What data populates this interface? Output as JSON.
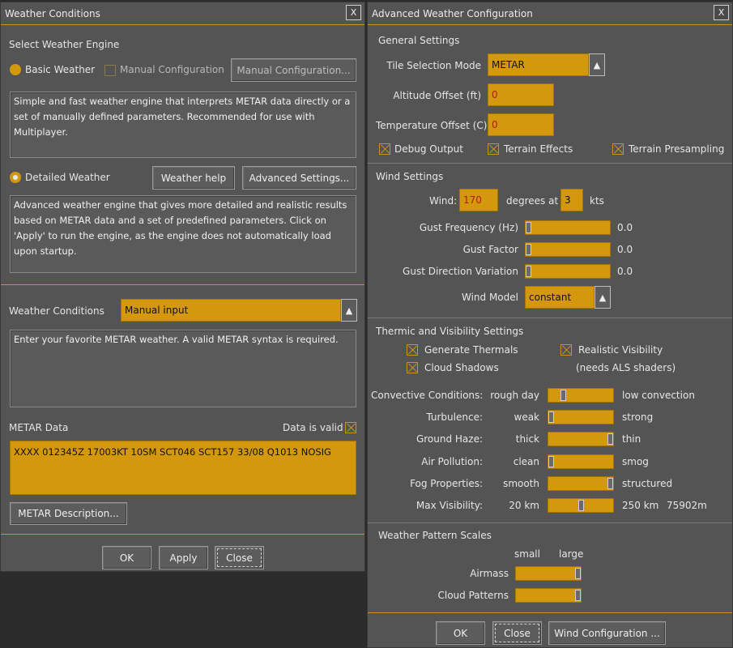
{
  "weather_conditions": {
    "title": "Weather Conditions",
    "close_x": "X",
    "select_engine_label": "Select Weather Engine",
    "basic_weather_label": "Basic Weather",
    "manual_config_check_label": "Manual Configuration",
    "manual_config_button": "Manual Configuration...",
    "basic_description": "Simple and fast weather engine that interprets METAR data directly or a set of manually defined parameters. Recommended for use with Multiplayer.",
    "detailed_weather_label": "Detailed Weather",
    "weather_help_button": "Weather help",
    "advanced_settings_button": "Advanced Settings...",
    "detailed_description": "Advanced weather engine that gives more detailed and realistic results based on METAR data and a set of predefined parameters. Click on 'Apply' to run the engine, as the engine does not automatically load upon startup.",
    "conditions_label": "Weather Conditions",
    "conditions_value": "Manual input",
    "conditions_description": "Enter your favorite METAR weather. A valid METAR syntax is required.",
    "metar_data_label": "METAR Data",
    "data_valid_label": "Data is valid",
    "metar_value": "XXXX 012345Z 17003KT 10SM SCT046 SCT157 33/08 Q1013 NOSIG",
    "metar_description_button": "METAR Description...",
    "ok_button": "OK",
    "apply_button": "Apply",
    "close_button": "Close"
  },
  "advanced": {
    "title": "Advanced Weather Configuration",
    "close_x": "X",
    "general_settings": "General Settings",
    "tile_selection_label": "Tile Selection Mode",
    "tile_selection_value": "METAR",
    "altitude_offset_label": "Altitude Offset (ft)",
    "altitude_offset_value": "0",
    "temperature_offset_label": "Temperature Offset (C)",
    "temperature_offset_value": "0",
    "debug_output": "Debug Output",
    "terrain_effects": "Terrain Effects",
    "terrain_presampling": "Terrain Presampling",
    "wind_settings": "Wind Settings",
    "wind_label": "Wind:",
    "wind_direction": "170",
    "degrees_at": "degrees at",
    "wind_speed": "3",
    "kts": "kts",
    "gust_frequency_label": "Gust Frequency (Hz)",
    "gust_frequency_value": "0.0",
    "gust_factor_label": "Gust Factor",
    "gust_factor_value": "0.0",
    "gust_direction_label": "Gust Direction Variation",
    "gust_direction_value": "0.0",
    "wind_model_label": "Wind Model",
    "wind_model_value": "constant",
    "thermic_settings": "Thermic and Visibility Settings",
    "generate_thermals": "Generate Thermals",
    "realistic_visibility": "Realistic Visibility",
    "cloud_shadows": "Cloud Shadows",
    "needs_als": "(needs ALS shaders)",
    "convective_label": "Convective Conditions:",
    "convective_min": "rough day",
    "convective_max": "low convection",
    "convective_level": 0.2,
    "turbulence_label": "Turbulence:",
    "turbulence_min": "weak",
    "turbulence_max": "strong",
    "turbulence_level": 0.0,
    "haze_label": "Ground Haze:",
    "haze_min": "thick",
    "haze_max": "thin",
    "haze_level": 1.0,
    "pollution_label": "Air Pollution:",
    "pollution_min": "clean",
    "pollution_max": "smog",
    "pollution_level": 0.0,
    "fog_label": "Fog Properties:",
    "fog_min": "smooth",
    "fog_max": "structured",
    "fog_level": 1.0,
    "visibility_label": "Max Visibility:",
    "visibility_min": "20 km",
    "visibility_max": "250 km",
    "visibility_value": "75902m",
    "visibility_level": 0.5,
    "pattern_scales": "Weather Pattern Scales",
    "small": "small",
    "large": "large",
    "airmass_label": "Airmass",
    "airmass_level": 1.0,
    "cloud_patterns_label": "Cloud Patterns",
    "cloud_patterns_level": 1.0,
    "ok_button": "OK",
    "close_button": "Close",
    "wind_config_button": "Wind Configuration ..."
  },
  "colors": {
    "accent": "#d4980c",
    "panel": "#545454",
    "field_text": "#ad1d0c"
  }
}
